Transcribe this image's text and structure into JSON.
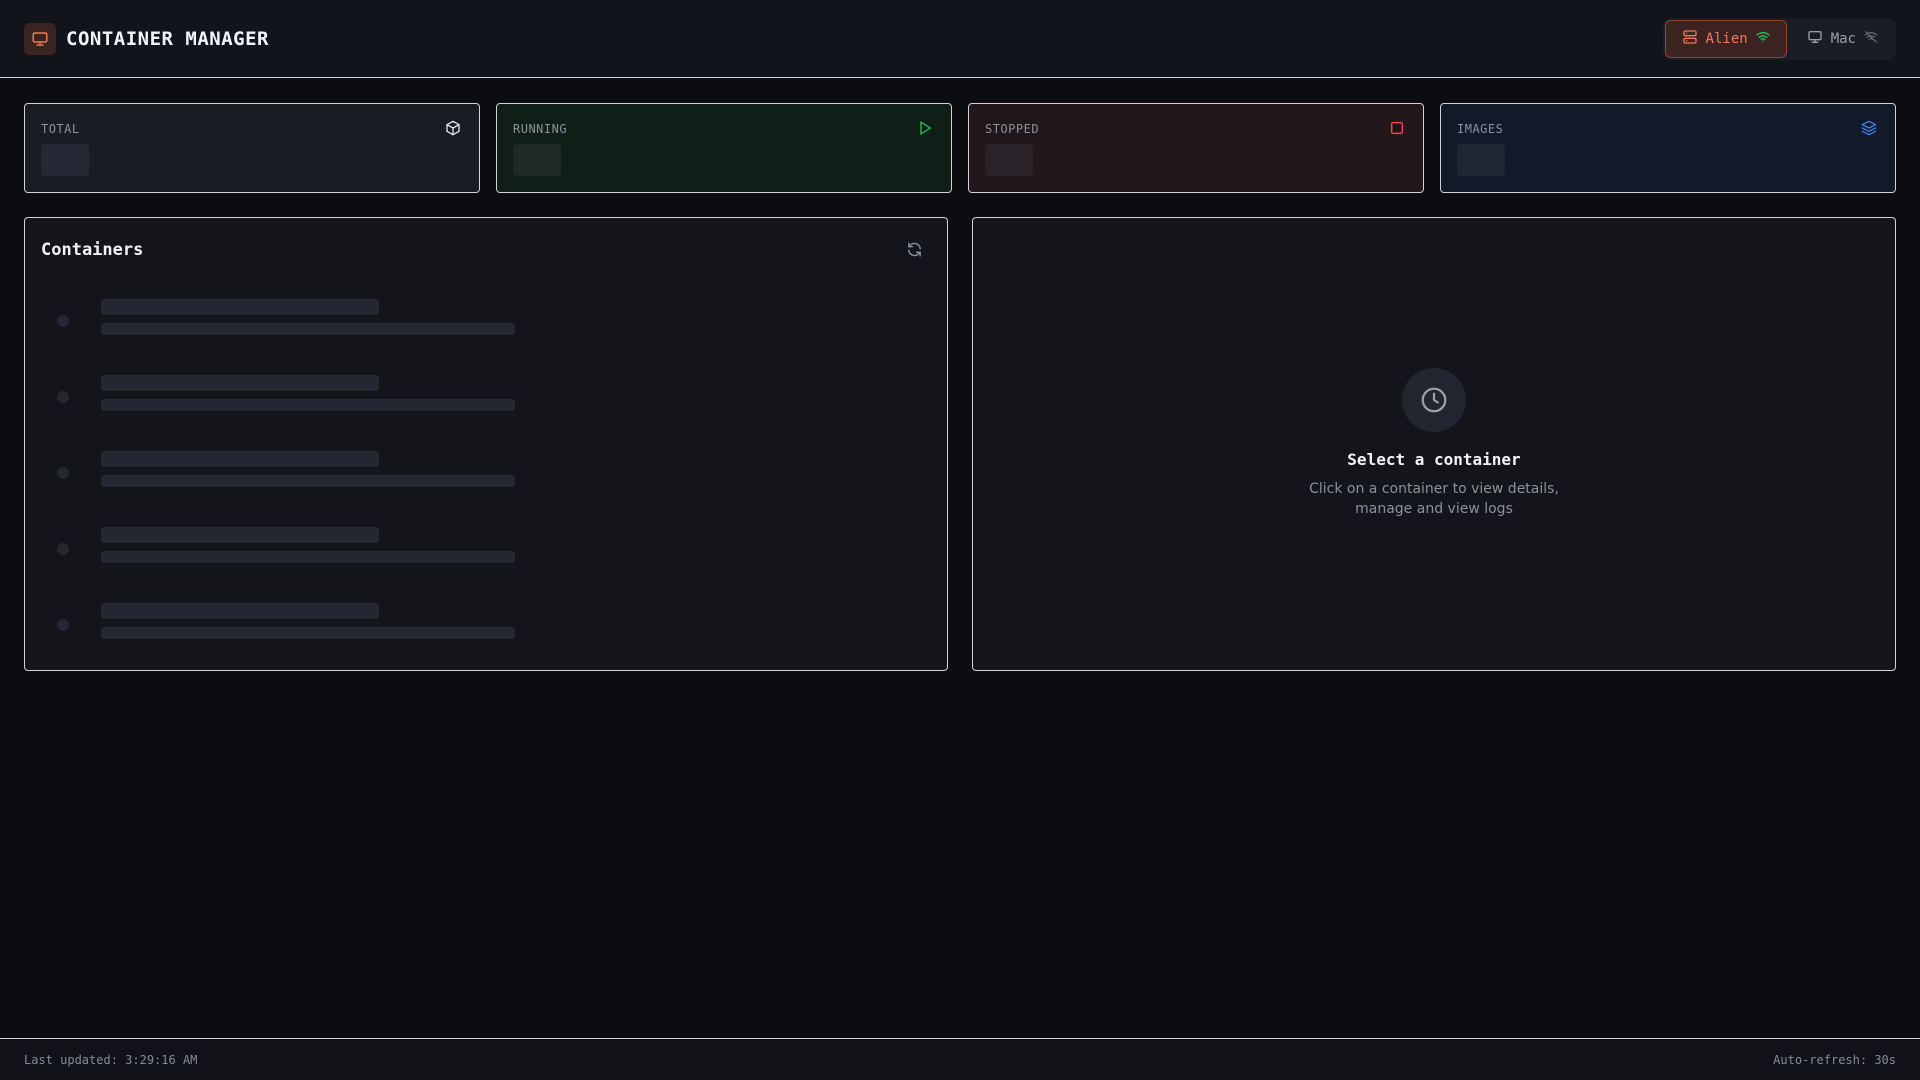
{
  "app": {
    "title": "CONTAINER MANAGER"
  },
  "hosts": [
    {
      "label": "Alien",
      "icon": "server-icon",
      "status_icon": "wifi-icon",
      "active": true
    },
    {
      "label": "Mac",
      "icon": "monitor-icon",
      "status_icon": "wifi-off-icon",
      "active": false
    }
  ],
  "stats": {
    "total": {
      "label": "TOTAL",
      "icon": "cube-icon",
      "color": "#e6e8ee"
    },
    "running": {
      "label": "RUNNING",
      "icon": "play-icon",
      "color": "#22c55e"
    },
    "stopped": {
      "label": "STOPPED",
      "icon": "square-icon",
      "color": "#ef4444"
    },
    "images": {
      "label": "IMAGES",
      "icon": "layers-icon",
      "color": "#3b82f6"
    }
  },
  "containers_panel": {
    "title": "Containers",
    "loading": true
  },
  "detail_panel": {
    "title": "Select a container",
    "subtitle": "Click on a container to view details, manage and view logs"
  },
  "footer": {
    "last_updated": "Last updated: 3:29:16 AM",
    "auto_refresh": "Auto-refresh: 30s"
  },
  "colors": {
    "accent": "#f07a5a",
    "running": "#22c55e",
    "stopped": "#ef4444",
    "images": "#3b82f6"
  }
}
